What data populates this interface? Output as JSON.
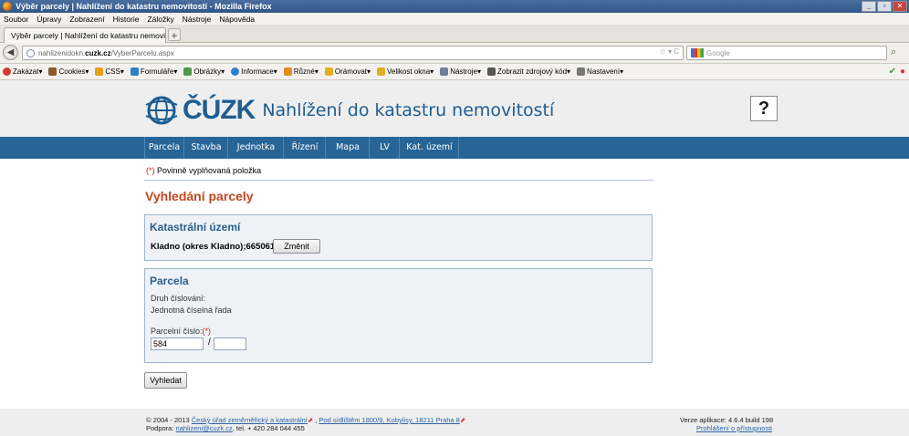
{
  "window": {
    "title": "Výběr parcely | Nahlížení do katastru nemovitostí - Mozilla Firefox",
    "controls": [
      "_",
      "▫",
      "✕"
    ]
  },
  "menu": [
    "Soubor",
    "Úpravy",
    "Zobrazení",
    "Historie",
    "Záložky",
    "Nástroje",
    "Nápověda"
  ],
  "tab": {
    "label": "Výběr parcely | Nahlížení do katastru nemovi...",
    "new_tab": "+"
  },
  "nav": {
    "url_prefix": "nahlizenidokn.",
    "url_domain": "cuzk.cz",
    "url_path": "/VyberParcelu.aspx",
    "url_right": "☆ ▾ C",
    "search_placeholder": "Google"
  },
  "devbar": {
    "items": [
      "Zakázat▾",
      "Cookies▾",
      "CSS▾",
      "Formuláře▾",
      "Obrázky▾",
      "Informace▾",
      "Různé▾",
      "Orámovat▾",
      "Velikost okna▾",
      "Nástroje▾",
      "Zobrazit zdrojový kód▾",
      "Nastavení▾"
    ],
    "icon_colors": [
      "#d33a2c",
      "#8a5a2a",
      "#e3a21a",
      "#2f7fc8",
      "#4a9a4a",
      "#2a7fd0",
      "#e38b1f",
      "#e0b020",
      "#e0b020",
      "#6a7fa0",
      "#555555",
      "#777777"
    ]
  },
  "header": {
    "logo_text": "ČÚZK",
    "tagline": "Nahlížení do katastru nemovitostí",
    "help": "?"
  },
  "mainnav": [
    "Parcela",
    "Stavba",
    "Jednotka",
    "Řízení",
    "Mapa",
    "LV",
    "Kat. území"
  ],
  "form": {
    "required_star": "(*)",
    "required_text": " Povinně vyplňovaná položka",
    "title": "Vyhledání parcely",
    "ku_title": "Katastrální území",
    "ku_value": "Kladno (okres Kladno);665061",
    "change_button": "Změnit",
    "parcela_title": "Parcela",
    "druh_label": "Druh číslování:",
    "druh_value": "Jednotná číselná řada",
    "parcel_label": "Parcelní číslo:",
    "parcel_star": "(*)",
    "parcel_number": "584",
    "slash": "/",
    "parcel_sub": "",
    "search_button": "Vyhledat"
  },
  "footer": {
    "copyright": "© 2004 - 2013 ",
    "org_link": "Český úřad zeměměřický a katastrální",
    "address_sep": " , ",
    "address_link": "Pod sídlištěm 1800/9, Kobylisy, 18211 Praha 8",
    "support_label": "Podpora: ",
    "support_email": "nahlizeni@cuzk.cz",
    "support_phone": ", tel. + 420 284 044 455",
    "version": "Verze aplikace: 4.6.4 build 198",
    "accessibility": "Prohlášení o přístupnosti"
  }
}
